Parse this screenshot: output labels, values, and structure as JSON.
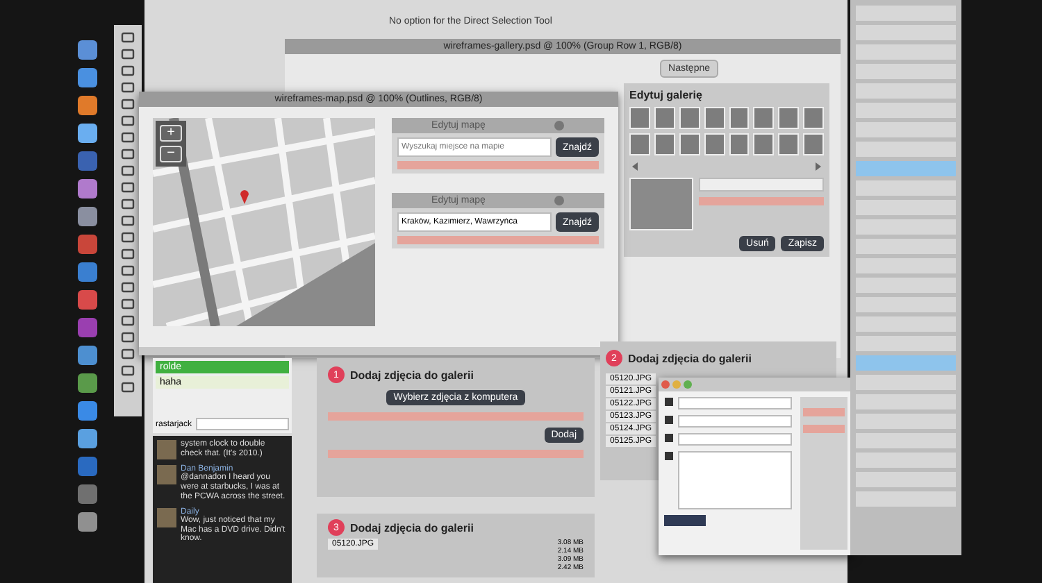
{
  "hint_bar": {
    "text": "No option for the Direct Selection Tool"
  },
  "gallery_window": {
    "title": "wireframes-gallery.psd @ 100% (Group Row 1, RGB/8)",
    "next_button": "Następne",
    "edit_gallery": {
      "title": "Edytuj galerię",
      "buttons": [
        "Usuń",
        "Zapisz"
      ]
    }
  },
  "map_window": {
    "title": "wireframes-map.psd @ 100% (Outlines, RGB/8)",
    "zoom_in": "+",
    "zoom_out": "−",
    "panels": [
      {
        "title": "Edytuj mapę",
        "placeholder": "Wyszukaj miejsce na mapie",
        "button": "Znajdź"
      },
      {
        "title": "Edytuj mapę",
        "value": "Kraków, Kazimierz, Wawrzyńca",
        "button": "Znajdź"
      }
    ]
  },
  "upload_sections": [
    {
      "number": "1",
      "title": "Dodaj zdjęcia do galerii",
      "button": "Wybierz zdjęcia z komputera",
      "submit": "Dodaj"
    },
    {
      "number": "2",
      "title": "Dodaj zdjęcia do galerii",
      "files": [
        "05120.JPG",
        "05121.JPG",
        "05122.JPG",
        "05123.JPG",
        "05124.JPG",
        "05125.JPG"
      ]
    },
    {
      "number": "3",
      "title": "Dodaj zdjęcia do galerii",
      "files": [
        "05120.JPG"
      ],
      "sizes": [
        "3.08 MB",
        "2.14 MB",
        "3.09 MB",
        "2.42 MB"
      ]
    }
  ],
  "chat": {
    "rows": [
      {
        "text": "rolde",
        "selected": true
      },
      {
        "text": "haha",
        "selected": false
      }
    ],
    "user": "rastarjack"
  },
  "tweets": [
    {
      "text": "system clock to double check that. (It's 2010.)"
    },
    {
      "name": "Dan Benjamin",
      "text": "@dannadon I heard you were at starbucks, I was at the PCWA across the street."
    },
    {
      "name": "Daily",
      "text": "Wow, just noticed that my Mac has a DVD drive. Didn't know."
    }
  ]
}
